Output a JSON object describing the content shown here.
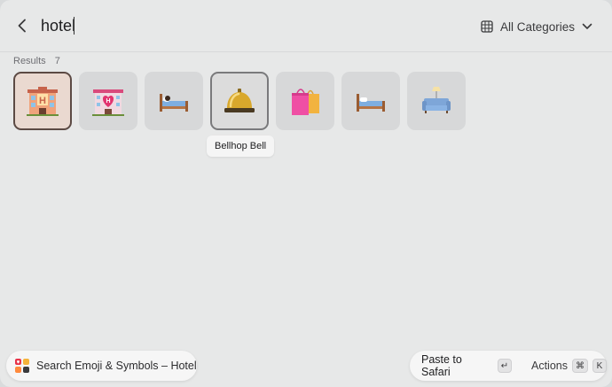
{
  "search": {
    "query": "hotel"
  },
  "category": {
    "selected": "All Categories"
  },
  "results": {
    "label": "Results",
    "count": "7",
    "items": [
      {
        "name": "Hotel",
        "emoji": "hotel-emoji"
      },
      {
        "name": "Love Hotel",
        "emoji": "love-hotel-emoji"
      },
      {
        "name": "Person in Bed",
        "emoji": "person-in-bed-emoji"
      },
      {
        "name": "Bellhop Bell",
        "emoji": "bellhop-bell-emoji"
      },
      {
        "name": "Shopping Bags",
        "emoji": "shopping-bags-emoji"
      },
      {
        "name": "Bed",
        "emoji": "bed-emoji"
      },
      {
        "name": "Couch and Lamp",
        "emoji": "couch-and-lamp-emoji"
      }
    ]
  },
  "tooltip": {
    "text": "Bellhop Bell"
  },
  "footer": {
    "command_title": "Search Emoji & Symbols – Hotel",
    "primary_action": "Paste to Safari",
    "primary_key": "↵",
    "secondary_action": "Actions",
    "secondary_keys": [
      "⌘",
      "K"
    ]
  },
  "colors": {
    "background": "#e7e8e8",
    "tile": "#d7d8d9",
    "selected_tile": "#ead9d0",
    "selected_border": "#5c4a44"
  }
}
